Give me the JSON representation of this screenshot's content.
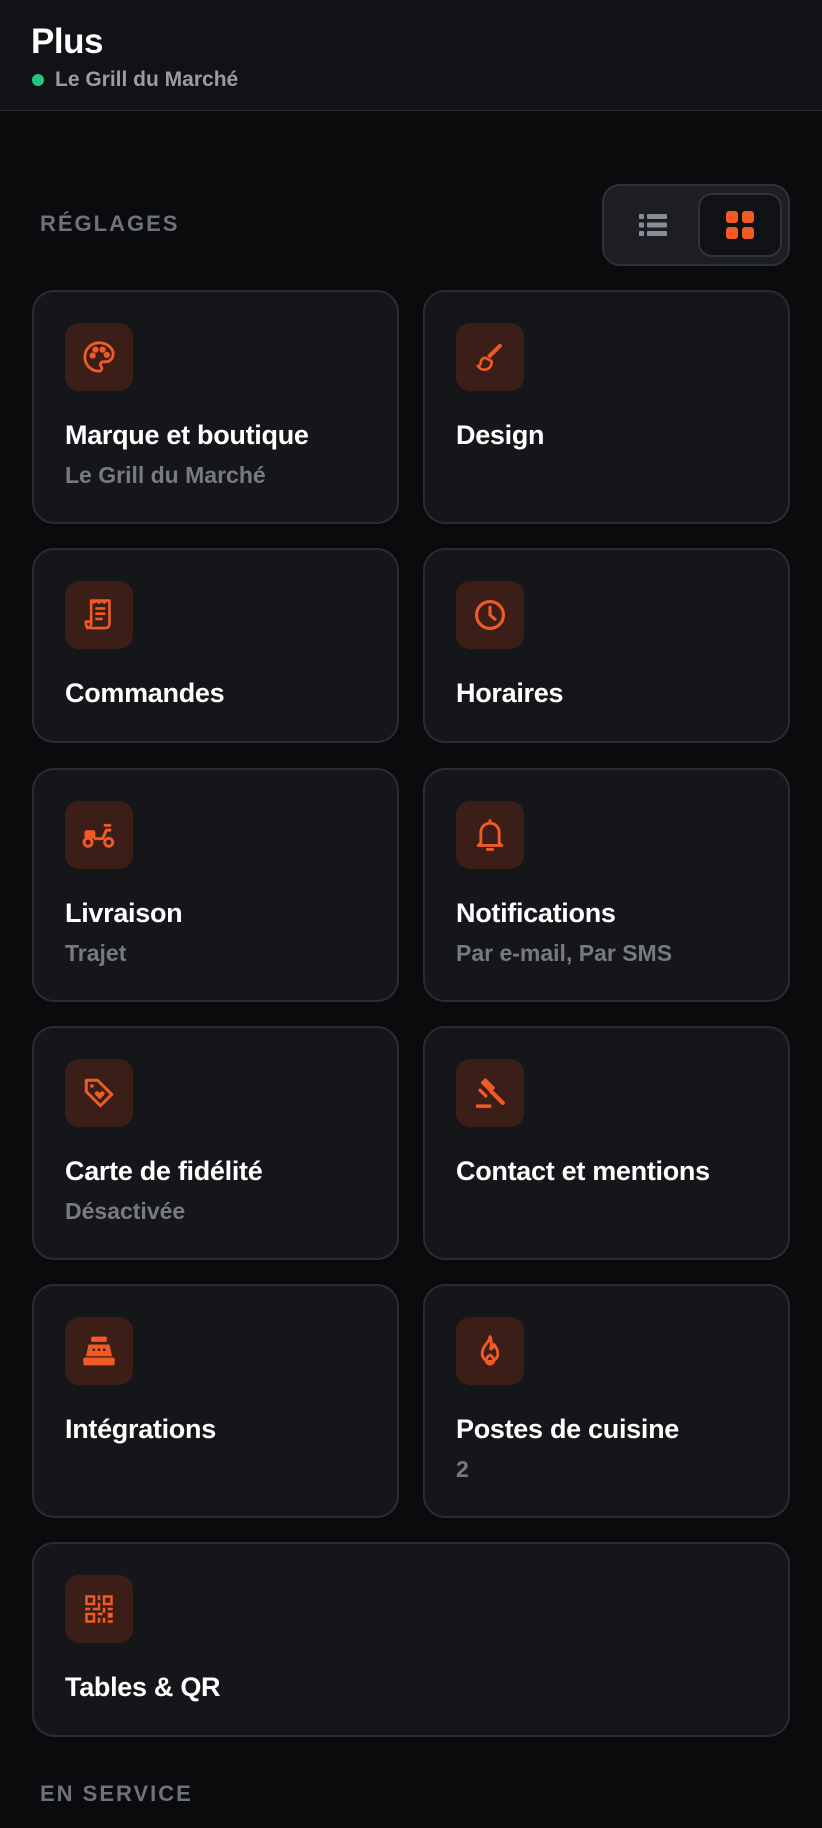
{
  "header": {
    "title": "Plus",
    "restaurant": "Le Grill du Marché",
    "status_color": "#22c77a"
  },
  "settings": {
    "section_label": "RÉGLAGES",
    "view_toggle": {
      "options": [
        "list-icon",
        "grid-icon"
      ],
      "selected": "grid"
    },
    "cards": [
      {
        "id": "brand",
        "icon": "palette-icon",
        "title": "Marque et boutique",
        "subtitle": "Le Grill du Marché"
      },
      {
        "id": "design",
        "icon": "paintbrush-icon",
        "title": "Design",
        "subtitle": ""
      },
      {
        "id": "orders",
        "icon": "receipt-icon",
        "title": "Commandes",
        "subtitle": ""
      },
      {
        "id": "hours",
        "icon": "clock-icon",
        "title": "Horaires",
        "subtitle": ""
      },
      {
        "id": "delivery",
        "icon": "scooter-icon",
        "title": "Livraison",
        "subtitle": "Trajet"
      },
      {
        "id": "notifications",
        "icon": "bell-icon",
        "title": "Notifications",
        "subtitle": "Par e-mail, Par SMS"
      },
      {
        "id": "loyalty",
        "icon": "tag-heart-icon",
        "title": "Carte de fidélité",
        "subtitle": "Désactivée"
      },
      {
        "id": "legal",
        "icon": "gavel-icon",
        "title": "Contact et mentions",
        "subtitle": ""
      },
      {
        "id": "integrations",
        "icon": "cash-register-icon",
        "title": "Intégrations",
        "subtitle": ""
      },
      {
        "id": "stations",
        "icon": "flame-icon",
        "title": "Postes de cuisine",
        "subtitle": "2"
      },
      {
        "id": "tables",
        "icon": "qr-code-icon",
        "title": "Tables & QR",
        "subtitle": ""
      }
    ]
  },
  "service": {
    "section_label": "EN SERVICE"
  },
  "colors": {
    "accent": "#f15a24",
    "icon_bg": "#3a1e17",
    "card_bg": "#15161a",
    "page_bg": "#0a0b0d"
  }
}
